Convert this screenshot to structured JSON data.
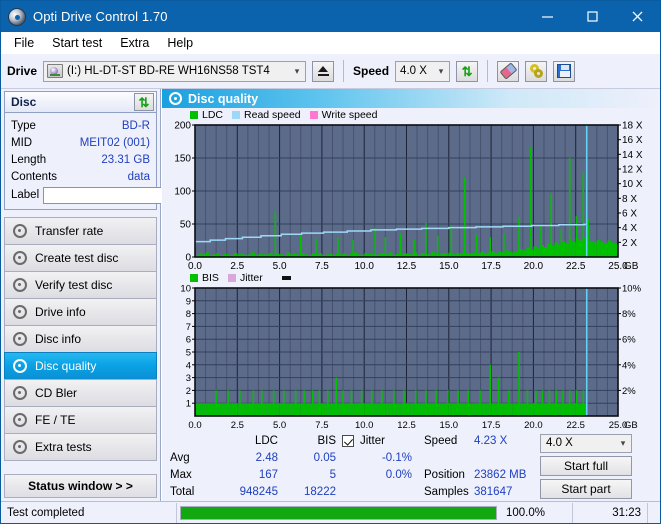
{
  "window": {
    "title": "Opti Drive Control 1.70",
    "icon": "disc-icon",
    "minimize": "minimize-icon",
    "maximize": "maximize-icon",
    "close": "close-icon"
  },
  "menu": [
    "File",
    "Start test",
    "Extra",
    "Help"
  ],
  "toolbar": {
    "drive_label": "Drive",
    "drive_value": "(I:)  HL-DT-ST BD-RE  WH16NS58 TST4",
    "eject_label": "eject-icon",
    "speed_label": "Speed",
    "speed_value": "4.0 X",
    "refresh_label": "refresh-icon",
    "eraser_label": "eraser-icon",
    "tools_label": "tools-icon",
    "save_label": "save-icon"
  },
  "disc_panel": {
    "title": "Disc",
    "refresh": "refresh-icon",
    "rows": [
      {
        "key": "Type",
        "value": "BD-R"
      },
      {
        "key": "MID",
        "value": "MEIT02 (001)"
      },
      {
        "key": "Length",
        "value": "23.31 GB"
      },
      {
        "key": "Contents",
        "value": "data"
      }
    ],
    "label_key": "Label",
    "label_value": ""
  },
  "sidebar": {
    "items": [
      {
        "label": "Transfer rate",
        "active": false
      },
      {
        "label": "Create test disc",
        "active": false
      },
      {
        "label": "Verify test disc",
        "active": false
      },
      {
        "label": "Drive info",
        "active": false
      },
      {
        "label": "Disc info",
        "active": false
      },
      {
        "label": "Disc quality",
        "active": true
      },
      {
        "label": "CD Bler",
        "active": false
      },
      {
        "label": "FE / TE",
        "active": false
      },
      {
        "label": "Extra tests",
        "active": false
      }
    ],
    "status_button": "Status window > >"
  },
  "main": {
    "title": "Disc quality"
  },
  "stats": {
    "col_ldc": "LDC",
    "col_bis": "BIS",
    "row_avg": "Avg",
    "row_max": "Max",
    "row_total": "Total",
    "ldc_avg": "2.48",
    "ldc_max": "167",
    "ldc_total": "948245",
    "bis_avg": "0.05",
    "bis_max": "5",
    "bis_total": "18222",
    "jitter_label": "Jitter",
    "jitter_checked": true,
    "jitter_avg": "-0.1%",
    "jitter_max": "0.0%",
    "speed_label": "Speed",
    "speed_value": "4.23 X",
    "position_label": "Position",
    "position_value": "23862 MB",
    "samples_label": "Samples",
    "samples_value": "381647",
    "speed_select": "4.0 X",
    "start_full": "Start full",
    "start_part": "Start part"
  },
  "statusbar": {
    "message": "Test completed",
    "percent": "100.0%",
    "elapsed": "31:23",
    "progress_value": 100
  },
  "colors": {
    "accent": "#0b63ae",
    "ldc_green": "#00c000",
    "bis_green": "#00c000",
    "read_speed": "#9fd8f5",
    "write_speed": "#ff77d0",
    "jitter": "#d8a8d8",
    "value_text": "#2040c0",
    "plot_bg": "#5c6b8a",
    "grid": "#3d4a63",
    "progress": "#11a811"
  },
  "chart_data": [
    {
      "type": "line",
      "id": "disc-quality-ldc",
      "title": "Disc quality",
      "xlabel": "GB",
      "ylabel": "LDC",
      "xlim": [
        0,
        25
      ],
      "ylim": [
        0,
        200
      ],
      "y2lim": [
        0,
        18
      ],
      "y2label": "X",
      "grid": true,
      "legend_position": "top-left",
      "xticks": [
        "0.0",
        "2.5",
        "5.0",
        "7.5",
        "10.0",
        "12.5",
        "15.0",
        "17.5",
        "20.0",
        "22.5",
        "25.0"
      ],
      "yticks": [
        0,
        50,
        100,
        150,
        200
      ],
      "y2ticks": [
        "2 X",
        "4 X",
        "6 X",
        "8 X",
        "10 X",
        "12 X",
        "14 X",
        "16 X",
        "18 X"
      ],
      "legend": [
        {
          "name": "LDC",
          "color": "#00c000"
        },
        {
          "name": "Read speed",
          "color": "#9fd8f5"
        },
        {
          "name": "Write speed",
          "color": "#ff77d0"
        }
      ],
      "series": [
        {
          "name": "LDC",
          "type": "impulse",
          "color": "#00c000",
          "baseline": [
            3,
            5,
            4,
            7,
            3,
            4,
            6,
            3,
            5,
            4,
            3,
            6,
            4,
            5,
            3,
            4,
            7,
            3,
            5,
            4,
            4,
            6,
            3,
            5,
            4,
            3,
            7,
            4,
            5,
            3,
            6,
            4,
            3,
            5,
            4,
            6,
            3,
            4,
            5,
            3,
            5,
            4,
            6,
            3,
            5,
            7,
            4,
            3,
            6,
            5,
            4,
            3,
            5,
            6,
            4,
            7,
            3,
            5,
            4,
            6,
            5,
            4,
            7,
            3,
            6,
            5,
            4,
            8,
            5,
            4,
            6,
            5,
            7,
            4,
            6,
            5,
            8,
            6,
            5,
            7,
            6,
            8,
            5,
            7,
            9,
            6,
            8,
            7,
            10,
            8,
            7,
            9,
            12,
            10,
            14,
            11,
            16,
            13,
            18,
            15,
            20,
            17,
            22,
            19,
            24,
            21,
            26,
            23,
            28,
            25,
            30,
            27,
            24,
            22,
            26,
            23,
            21,
            25,
            22,
            20
          ],
          "spikes": [
            {
              "x": 4.7,
              "y": 70
            },
            {
              "x": 6.2,
              "y": 33
            },
            {
              "x": 7.1,
              "y": 28
            },
            {
              "x": 8.4,
              "y": 30
            },
            {
              "x": 9.3,
              "y": 26
            },
            {
              "x": 10.6,
              "y": 44
            },
            {
              "x": 11.2,
              "y": 30
            },
            {
              "x": 12.1,
              "y": 35
            },
            {
              "x": 12.9,
              "y": 27
            },
            {
              "x": 13.6,
              "y": 52
            },
            {
              "x": 14.3,
              "y": 32
            },
            {
              "x": 15.1,
              "y": 48
            },
            {
              "x": 15.9,
              "y": 120
            },
            {
              "x": 16.6,
              "y": 34
            },
            {
              "x": 17.4,
              "y": 30
            },
            {
              "x": 18.2,
              "y": 36
            },
            {
              "x": 19.1,
              "y": 60
            },
            {
              "x": 19.8,
              "y": 167
            },
            {
              "x": 20.4,
              "y": 48
            },
            {
              "x": 21.0,
              "y": 95
            },
            {
              "x": 21.6,
              "y": 42
            },
            {
              "x": 22.1,
              "y": 150
            },
            {
              "x": 22.5,
              "y": 62
            },
            {
              "x": 22.9,
              "y": 128
            },
            {
              "x": 23.2,
              "y": 58
            }
          ]
        },
        {
          "name": "Read speed",
          "type": "step-line",
          "color": "#9fd8f5",
          "points": [
            {
              "x": 0.0,
              "y": 2.1
            },
            {
              "x": 0.9,
              "y": 2.3
            },
            {
              "x": 1.8,
              "y": 2.5
            },
            {
              "x": 2.8,
              "y": 2.7
            },
            {
              "x": 3.9,
              "y": 2.9
            },
            {
              "x": 5.1,
              "y": 3.1
            },
            {
              "x": 6.3,
              "y": 3.25
            },
            {
              "x": 7.6,
              "y": 3.4
            },
            {
              "x": 9.0,
              "y": 3.55
            },
            {
              "x": 10.4,
              "y": 3.7
            },
            {
              "x": 11.9,
              "y": 3.8
            },
            {
              "x": 13.4,
              "y": 3.9
            },
            {
              "x": 15.0,
              "y": 4.0
            },
            {
              "x": 16.6,
              "y": 4.1
            },
            {
              "x": 18.2,
              "y": 4.2
            },
            {
              "x": 19.9,
              "y": 4.3
            },
            {
              "x": 21.5,
              "y": 4.4
            },
            {
              "x": 23.0,
              "y": 4.45
            },
            {
              "x": 23.15,
              "y": 18.0
            }
          ]
        }
      ]
    },
    {
      "type": "line",
      "id": "disc-quality-bis",
      "xlabel": "GB",
      "ylabel": "BIS",
      "xlim": [
        0,
        25
      ],
      "ylim": [
        0,
        10
      ],
      "y2lim": [
        0,
        10
      ],
      "y2label": "%",
      "grid": true,
      "legend_position": "top-left",
      "xticks": [
        "0.0",
        "2.5",
        "5.0",
        "7.5",
        "10.0",
        "12.5",
        "15.0",
        "17.5",
        "20.0",
        "22.5",
        "25.0"
      ],
      "yticks": [
        1,
        2,
        3,
        4,
        5,
        6,
        7,
        8,
        9,
        10
      ],
      "y2ticks": [
        "2%",
        "4%",
        "6%",
        "8%",
        "10%"
      ],
      "legend": [
        {
          "name": "BIS",
          "color": "#00c000"
        },
        {
          "name": "Jitter",
          "color": "#d8a8d8"
        }
      ],
      "series": [
        {
          "name": "BIS",
          "type": "impulse",
          "color": "#00c000",
          "baseline_level": 1,
          "spikes": [
            {
              "x": 1.2,
              "y": 2
            },
            {
              "x": 1.9,
              "y": 2
            },
            {
              "x": 2.6,
              "y": 2
            },
            {
              "x": 3.4,
              "y": 2
            },
            {
              "x": 3.9,
              "y": 2
            },
            {
              "x": 4.6,
              "y": 2
            },
            {
              "x": 5.2,
              "y": 2
            },
            {
              "x": 5.9,
              "y": 2
            },
            {
              "x": 6.4,
              "y": 2
            },
            {
              "x": 6.9,
              "y": 2
            },
            {
              "x": 7.3,
              "y": 2
            },
            {
              "x": 7.8,
              "y": 2
            },
            {
              "x": 8.3,
              "y": 3
            },
            {
              "x": 8.7,
              "y": 2
            },
            {
              "x": 9.2,
              "y": 2
            },
            {
              "x": 9.8,
              "y": 2
            },
            {
              "x": 10.4,
              "y": 2
            },
            {
              "x": 11.0,
              "y": 2
            },
            {
              "x": 11.7,
              "y": 2
            },
            {
              "x": 12.3,
              "y": 2
            },
            {
              "x": 13.0,
              "y": 2
            },
            {
              "x": 13.6,
              "y": 2
            },
            {
              "x": 14.2,
              "y": 2
            },
            {
              "x": 14.9,
              "y": 2
            },
            {
              "x": 15.5,
              "y": 2
            },
            {
              "x": 16.1,
              "y": 2
            },
            {
              "x": 16.8,
              "y": 2
            },
            {
              "x": 17.4,
              "y": 4
            },
            {
              "x": 17.9,
              "y": 3
            },
            {
              "x": 18.5,
              "y": 2
            },
            {
              "x": 19.1,
              "y": 5
            },
            {
              "x": 19.6,
              "y": 2
            },
            {
              "x": 20.1,
              "y": 2
            },
            {
              "x": 20.5,
              "y": 2
            },
            {
              "x": 20.9,
              "y": 2
            },
            {
              "x": 21.3,
              "y": 2
            },
            {
              "x": 21.7,
              "y": 2
            },
            {
              "x": 22.1,
              "y": 2
            },
            {
              "x": 22.5,
              "y": 2
            },
            {
              "x": 22.9,
              "y": 2
            }
          ]
        },
        {
          "name": "Jitter",
          "type": "line",
          "color": "#d8a8d8",
          "points": []
        }
      ]
    }
  ]
}
